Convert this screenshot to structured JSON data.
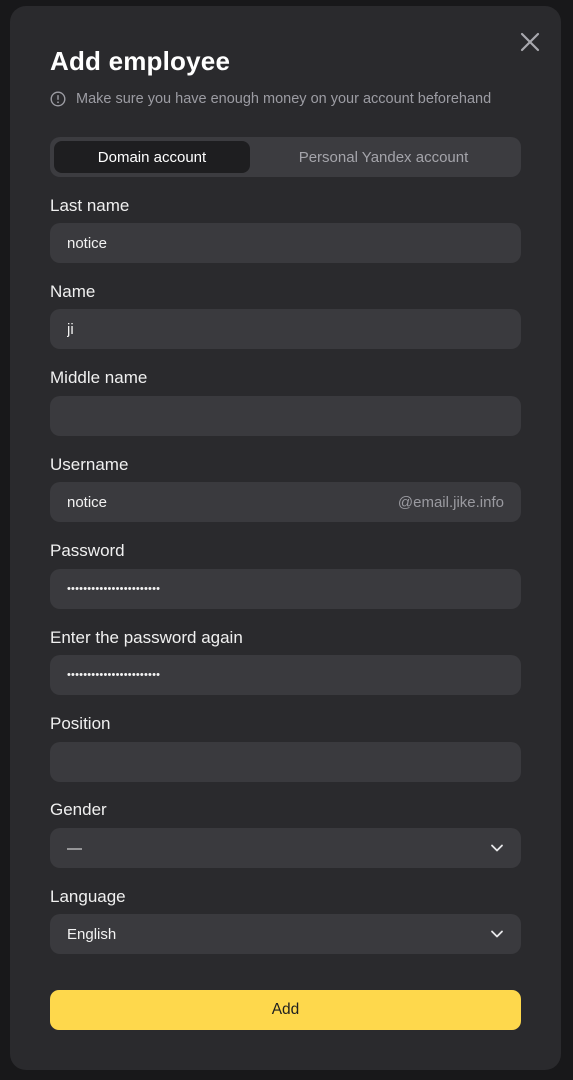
{
  "dialog": {
    "title": "Add employee",
    "notice": "Make sure you have enough money on your account beforehand",
    "account_types": {
      "selected": "Domain account",
      "options": [
        "Domain account",
        "Personal Yandex account"
      ]
    },
    "fields": {
      "last_name": {
        "label": "Last name",
        "value": "notice"
      },
      "name": {
        "label": "Name",
        "value": "ji"
      },
      "middle_name": {
        "label": "Middle name",
        "value": ""
      },
      "username": {
        "label": "Username",
        "value": "notice",
        "domain": "@email.jike.info"
      },
      "password": {
        "label": "Password",
        "masked": "•••••••••••••••••••••••"
      },
      "password_repeat": {
        "label": "Enter the password again",
        "masked": "•••••••••••••••••••••••"
      },
      "position": {
        "label": "Position",
        "value": ""
      },
      "gender": {
        "label": "Gender",
        "value": "—"
      },
      "language": {
        "label": "Language",
        "value": "English"
      }
    },
    "submit_label": "Add"
  },
  "colors": {
    "background": "#18181a",
    "dialog": "#2a2a2d",
    "input": "#3a3a3e",
    "accent": "#fed84c"
  },
  "icons": {
    "close": "close-icon",
    "info": "info-icon",
    "dropdown": "chevron-down-icon"
  }
}
